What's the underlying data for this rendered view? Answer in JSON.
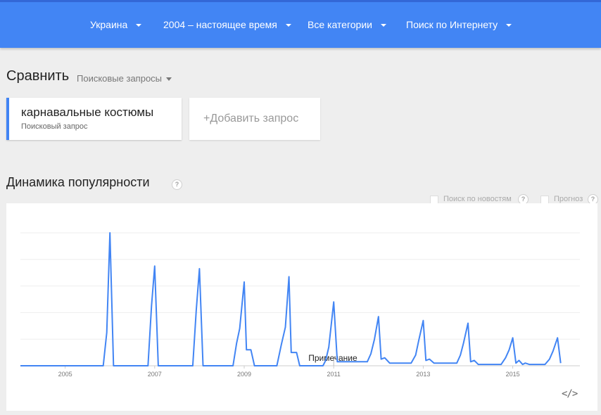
{
  "filters": [
    {
      "label": "Украина"
    },
    {
      "label": "2004 – настоящее время"
    },
    {
      "label": "Все категории"
    },
    {
      "label": "Поиск по Интернету"
    }
  ],
  "compare": {
    "title": "Сравнить",
    "type_label": "Поисковые запросы"
  },
  "term": {
    "name": "карнавальные костюмы",
    "subtitle": "Поисковый запрос",
    "color": "#4285f4"
  },
  "add_term": {
    "label": "+Добавить запрос"
  },
  "popularity": {
    "title": "Динамика популярности",
    "help": "?"
  },
  "options": {
    "news_label": "Поиск по новостям",
    "forecast_label": "Прогноз",
    "help": "?"
  },
  "embed_icon": "code-icon",
  "chart_data": {
    "type": "line",
    "title": "",
    "xlabel": "",
    "ylabel": "",
    "xlim": [
      2004.0,
      2016.5
    ],
    "ylim": [
      0,
      100
    ],
    "grid": true,
    "x_ticks": [
      2005,
      2007,
      2009,
      2011,
      2013,
      2015
    ],
    "x_tick_labels": [
      "2005",
      "2007",
      "2009",
      "2011",
      "2013",
      "2015"
    ],
    "annotation": {
      "label": "Примечание",
      "x": 2011.0
    },
    "series": [
      {
        "color": "#4285f4",
        "points": [
          [
            2004.0,
            0
          ],
          [
            2005.85,
            0
          ],
          [
            2005.93,
            25
          ],
          [
            2006.0,
            100
          ],
          [
            2006.08,
            0
          ],
          [
            2006.85,
            0
          ],
          [
            2006.93,
            45
          ],
          [
            2007.0,
            75
          ],
          [
            2007.08,
            0
          ],
          [
            2007.85,
            0
          ],
          [
            2007.93,
            42
          ],
          [
            2008.0,
            73
          ],
          [
            2008.08,
            0
          ],
          [
            2008.75,
            0
          ],
          [
            2008.83,
            17
          ],
          [
            2008.9,
            28
          ],
          [
            2009.0,
            63
          ],
          [
            2009.05,
            12
          ],
          [
            2009.15,
            12
          ],
          [
            2009.23,
            0
          ],
          [
            2009.73,
            0
          ],
          [
            2009.83,
            16
          ],
          [
            2009.92,
            29
          ],
          [
            2010.0,
            67
          ],
          [
            2010.05,
            10
          ],
          [
            2010.17,
            10
          ],
          [
            2010.24,
            0
          ],
          [
            2010.76,
            0
          ],
          [
            2010.82,
            4
          ],
          [
            2010.89,
            14
          ],
          [
            2011.0,
            48
          ],
          [
            2011.08,
            3
          ],
          [
            2011.75,
            3
          ],
          [
            2011.83,
            9
          ],
          [
            2011.91,
            20
          ],
          [
            2012.0,
            37
          ],
          [
            2012.06,
            5
          ],
          [
            2012.14,
            6
          ],
          [
            2012.25,
            2
          ],
          [
            2012.73,
            2
          ],
          [
            2012.83,
            8
          ],
          [
            2012.9,
            19
          ],
          [
            2013.0,
            34
          ],
          [
            2013.06,
            4
          ],
          [
            2013.14,
            5
          ],
          [
            2013.24,
            2
          ],
          [
            2013.75,
            2
          ],
          [
            2013.83,
            8
          ],
          [
            2013.9,
            17
          ],
          [
            2014.0,
            32
          ],
          [
            2014.06,
            3
          ],
          [
            2014.14,
            4
          ],
          [
            2014.23,
            1
          ],
          [
            2014.74,
            1
          ],
          [
            2014.84,
            6
          ],
          [
            2014.92,
            12
          ],
          [
            2015.0,
            21
          ],
          [
            2015.07,
            2
          ],
          [
            2015.14,
            4
          ],
          [
            2015.22,
            1
          ],
          [
            2015.28,
            2
          ],
          [
            2015.37,
            1
          ],
          [
            2015.72,
            1
          ],
          [
            2015.82,
            5
          ],
          [
            2015.9,
            11
          ],
          [
            2016.0,
            21
          ],
          [
            2016.07,
            2
          ]
        ]
      }
    ]
  }
}
